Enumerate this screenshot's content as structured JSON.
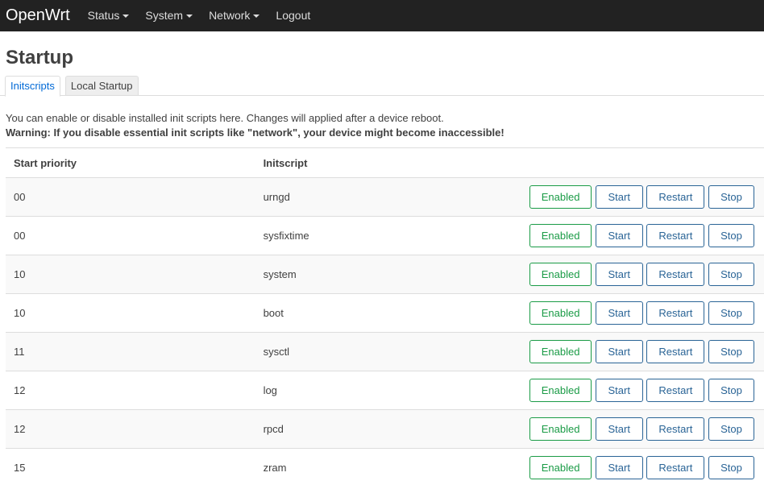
{
  "navbar": {
    "brand": "OpenWrt",
    "menus": [
      "Status",
      "System",
      "Network"
    ],
    "logout": "Logout"
  },
  "page": {
    "title": "Startup",
    "tabs": [
      "Initscripts",
      "Local Startup"
    ],
    "active_tab": "Initscripts",
    "description": "You can enable or disable installed init scripts here. Changes will applied after a device reboot.",
    "warning": "Warning: If you disable essential init scripts like \"network\", your device might become inaccessible!"
  },
  "table": {
    "headers": [
      "Start priority",
      "Initscript"
    ],
    "rows": [
      {
        "priority": "00",
        "script": "urngd"
      },
      {
        "priority": "00",
        "script": "sysfixtime"
      },
      {
        "priority": "10",
        "script": "system"
      },
      {
        "priority": "10",
        "script": "boot"
      },
      {
        "priority": "11",
        "script": "sysctl"
      },
      {
        "priority": "12",
        "script": "log"
      },
      {
        "priority": "12",
        "script": "rpcd"
      },
      {
        "priority": "15",
        "script": "zram"
      }
    ],
    "buttons": {
      "enabled": "Enabled",
      "start": "Start",
      "restart": "Restart",
      "stop": "Stop"
    }
  },
  "colors": {
    "navbar_bg": "#222222",
    "enabled_green": "#1a9b46",
    "action_blue": "#2a6496",
    "active_tab_blue": "#0069d6"
  }
}
